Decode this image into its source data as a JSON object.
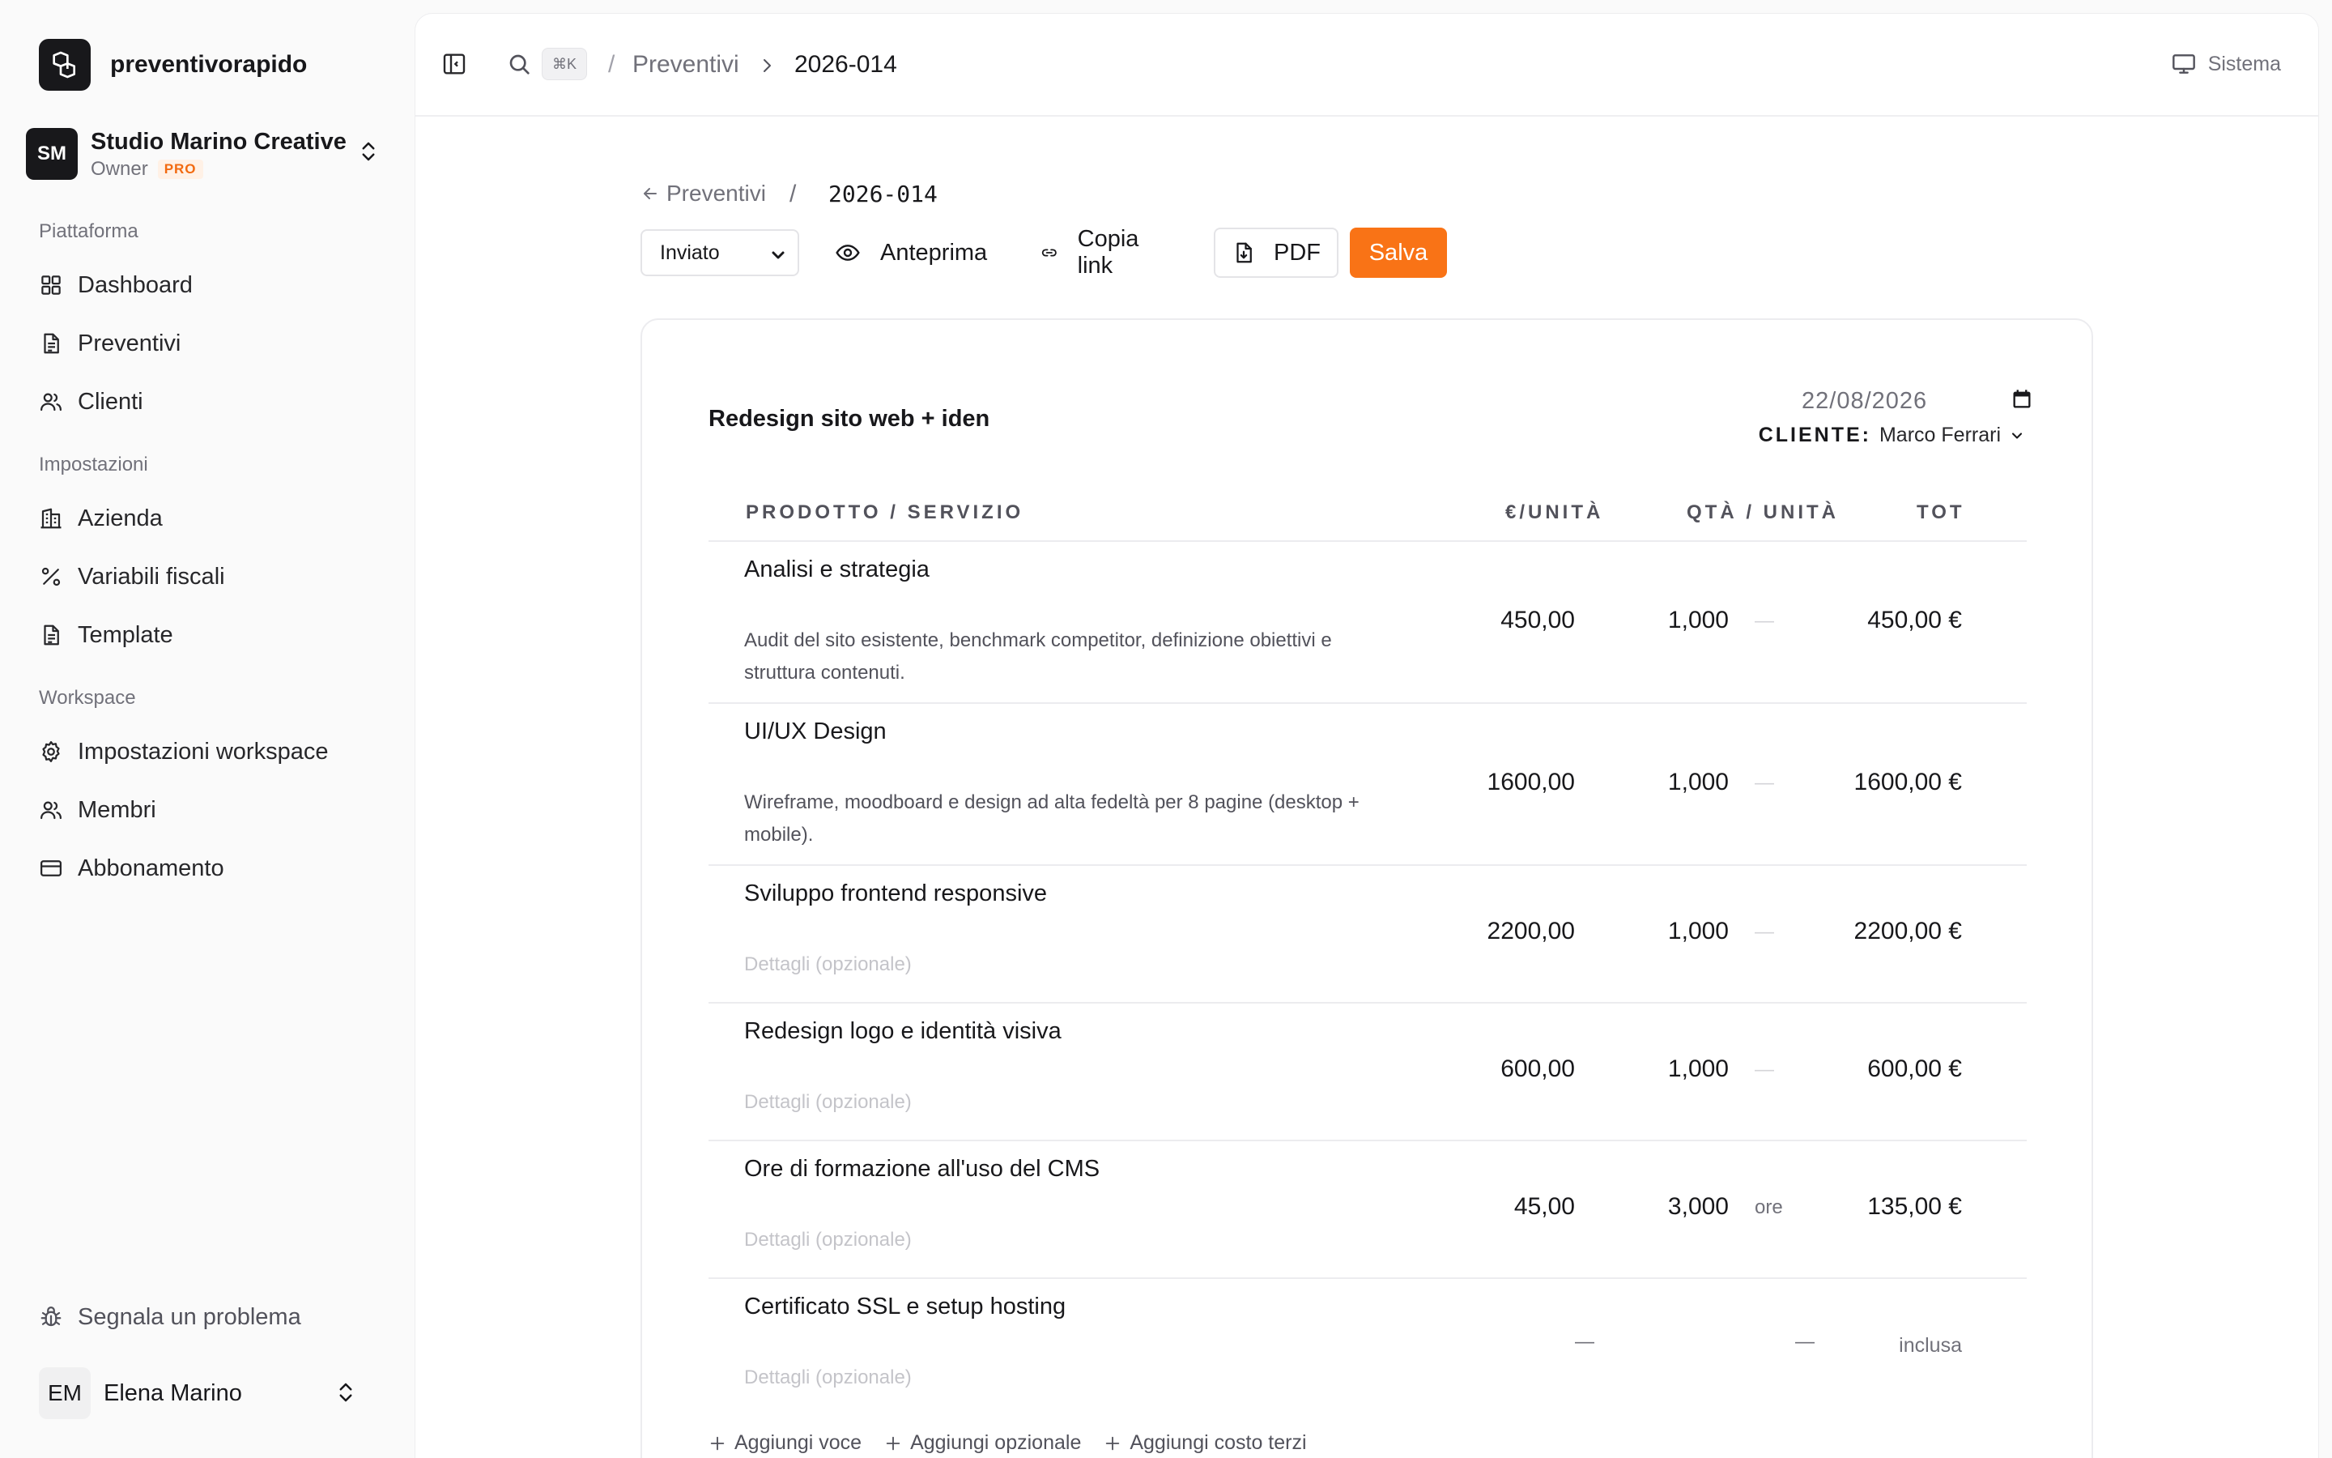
{
  "app": {
    "name": "preventivorapido"
  },
  "org": {
    "initials": "SM",
    "name": "Studio Marino Creative",
    "role": "Owner",
    "badge": "PRO"
  },
  "nav": {
    "groups": [
      {
        "label": "Piattaforma",
        "items": [
          {
            "label": "Dashboard",
            "icon": "grid-icon"
          },
          {
            "label": "Preventivi",
            "icon": "document-icon"
          },
          {
            "label": "Clienti",
            "icon": "users-icon"
          }
        ]
      },
      {
        "label": "Impostazioni",
        "items": [
          {
            "label": "Azienda",
            "icon": "building-icon"
          },
          {
            "label": "Variabili fiscali",
            "icon": "percent-icon"
          },
          {
            "label": "Template",
            "icon": "document-icon"
          }
        ]
      },
      {
        "label": "Workspace",
        "items": [
          {
            "label": "Impostazioni workspace",
            "icon": "gear-icon"
          },
          {
            "label": "Membri",
            "icon": "users-icon"
          },
          {
            "label": "Abbonamento",
            "icon": "credit-card-icon"
          }
        ]
      }
    ],
    "report": "Segnala un problema"
  },
  "user": {
    "initials": "EM",
    "name": "Elena Marino"
  },
  "topbar": {
    "shortcut": "⌘K",
    "slash": "/",
    "breadcrumb": [
      "Preventivi",
      "2026-014"
    ],
    "theme": "Sistema"
  },
  "header": {
    "back": "Preventivi",
    "slash": "/",
    "number": "2026-014"
  },
  "toolbar": {
    "status": "Inviato",
    "preview": "Anteprima",
    "copy_link": "Copia link",
    "pdf": "PDF",
    "save": "Salva"
  },
  "quote": {
    "title": "Redesign sito web + iden",
    "date": "22/08/2026",
    "client_label": "CLIENTE:",
    "client_name": "Marco Ferrari"
  },
  "table": {
    "headers": {
      "product": "PRODOTTO / SERVIZIO",
      "unit_price": "€/UNITÀ",
      "qty": "QTÀ / UNITÀ",
      "total": "TOT"
    },
    "rows": [
      {
        "name": "Analisi e strategia",
        "desc": "Audit del sito esistente, benchmark competitor, definizione obiettivi e struttura contenuti.",
        "price": "450,00",
        "qty": "1,000",
        "unit": "—",
        "total": "450,00 €"
      },
      {
        "name": "UI/UX Design",
        "desc": "Wireframe, moodboard e design ad alta fedeltà per 8 pagine (desktop + mobile).",
        "price": "1600,00",
        "qty": "1,000",
        "unit": "—",
        "total": "1600,00 €"
      },
      {
        "name": "Sviluppo frontend responsive",
        "desc": "Dettagli (opzionale)",
        "price": "2200,00",
        "qty": "1,000",
        "unit": "—",
        "total": "2200,00 €"
      },
      {
        "name": "Redesign logo e identità visiva",
        "desc": "Dettagli (opzionale)",
        "price": "600,00",
        "qty": "1,000",
        "unit": "—",
        "total": "600,00 €"
      },
      {
        "name": "Ore di formazione all'uso del CMS",
        "desc": "Dettagli (opzionale)",
        "price": "45,00",
        "qty": "3,000",
        "unit": "ore",
        "total": "135,00 €"
      },
      {
        "name": "Certificato SSL e setup hosting",
        "desc": "Dettagli (opzionale)",
        "price": "—",
        "qty": "—",
        "unit": "",
        "total": "inclusa"
      }
    ]
  },
  "actions": {
    "add_item": "Aggiungi voce",
    "add_optional": "Aggiungi opzionale",
    "add_third": "Aggiungi costo terzi"
  },
  "colors": {
    "accent": "#f97316",
    "dark": "#18181b",
    "muted": "#71717a",
    "border": "#ececef"
  }
}
